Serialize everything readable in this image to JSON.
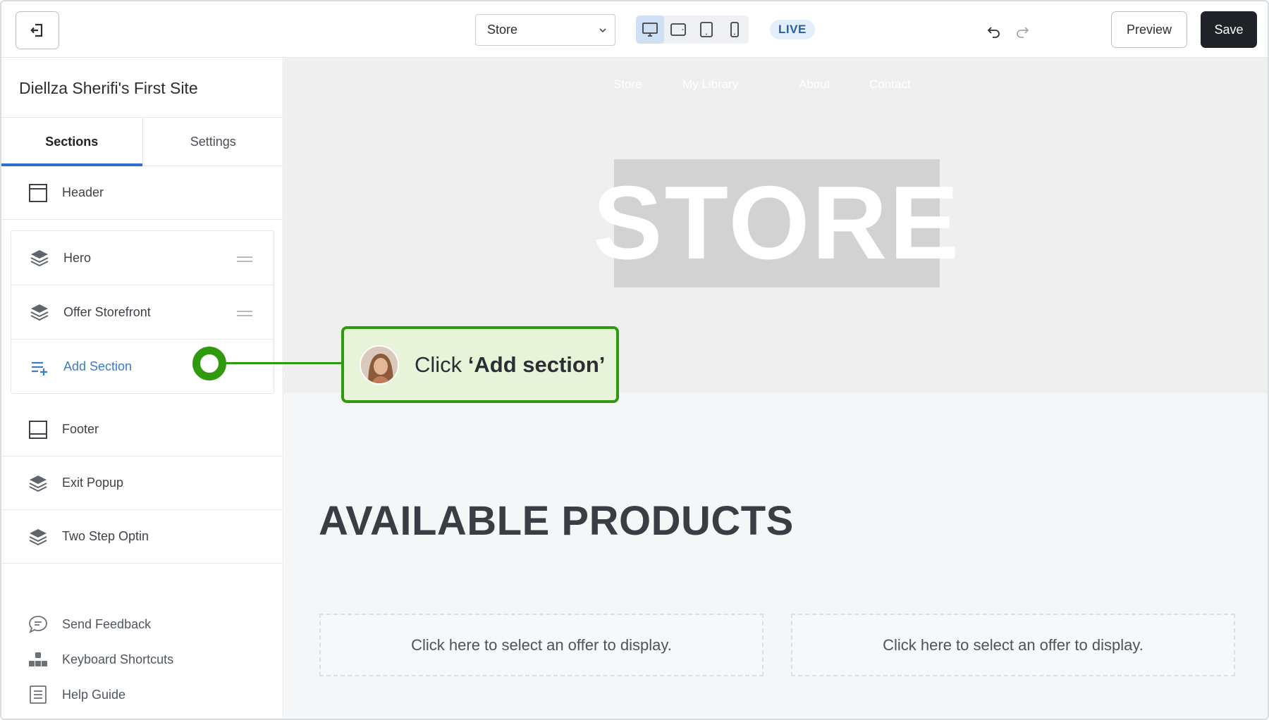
{
  "toolbar": {
    "exit_icon": "exit-icon",
    "page_select": "Store",
    "devices": [
      "desktop",
      "tablet-landscape",
      "tablet-portrait",
      "mobile"
    ],
    "live_badge": "LIVE",
    "preview_label": "Preview",
    "save_label": "Save"
  },
  "sidebar": {
    "site_title": "Diellza Sherifi's First Site",
    "tabs": [
      {
        "label": "Sections",
        "active": true
      },
      {
        "label": "Settings",
        "active": false
      }
    ],
    "header_label": "Header",
    "body_sections": [
      {
        "label": "Hero"
      },
      {
        "label": "Offer Storefront"
      }
    ],
    "add_section_label": "Add Section",
    "footer_label": "Footer",
    "popups": [
      {
        "label": "Exit Popup"
      },
      {
        "label": "Two Step Optin"
      }
    ],
    "utilities": [
      {
        "label": "Send Feedback",
        "icon": "chat-bubble-icon"
      },
      {
        "label": "Keyboard Shortcuts",
        "icon": "keyboard-icon"
      },
      {
        "label": "Help Guide",
        "icon": "document-icon"
      }
    ]
  },
  "canvas": {
    "nav_links": [
      "Store",
      "My Library",
      "About",
      "Contact"
    ],
    "banner_text": "STORE",
    "products_title": "AVAILABLE PRODUCTS",
    "offer_placeholders": [
      "Click here to select an offer to display.",
      "Click here to select an offer to display."
    ]
  },
  "callout": {
    "prefix": "Click ",
    "emphasis": "‘Add section’"
  },
  "colors": {
    "accent": "#2f6fd0",
    "callout_green": "#2f9a10",
    "callout_bg": "#e8f4d9",
    "save_bg": "#1f2226"
  }
}
